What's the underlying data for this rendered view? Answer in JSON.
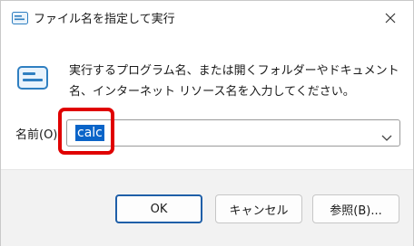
{
  "window": {
    "title": "ファイル名を指定して実行",
    "close_icon": "close-icon"
  },
  "body": {
    "description": "実行するプログラム名、または開くフォルダーやドキュメント名、インターネット リソース名を入力してください。",
    "field_label": "名前(O):",
    "input_value": "calc"
  },
  "buttons": {
    "ok": "OK",
    "cancel": "キャンセル",
    "browse": "参照(B)..."
  },
  "colors": {
    "selection": "#0a64c8",
    "highlight_box": "#e00000",
    "primary_border": "#1f5fa8"
  }
}
